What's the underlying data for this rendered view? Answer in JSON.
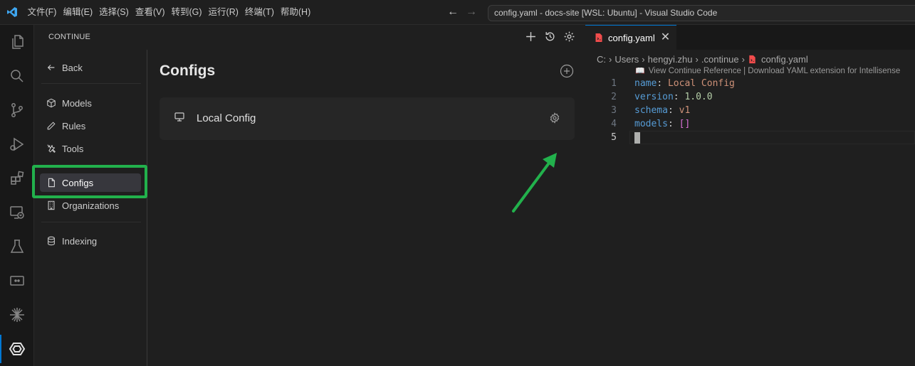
{
  "menu": [
    "文件(F)",
    "编辑(E)",
    "选择(S)",
    "查看(V)",
    "转到(G)",
    "运行(R)",
    "终端(T)",
    "帮助(H)"
  ],
  "window_title": "config.yaml - docs-site [WSL: Ubuntu] - Visual Studio Code",
  "sidebar": {
    "title": "CONTINUE",
    "nav": {
      "back": "Back",
      "models": "Models",
      "rules": "Rules",
      "tools": "Tools",
      "configs": "Configs",
      "organizations": "Organizations",
      "indexing": "Indexing"
    },
    "selected": "Configs"
  },
  "configs": {
    "title": "Configs",
    "items": [
      {
        "name": "Local Config"
      }
    ]
  },
  "editor": {
    "tab": {
      "label": "config.yaml"
    },
    "breadcrumbs": [
      "C:",
      "Users",
      "hengyi.zhu",
      ".continue",
      "config.yaml"
    ],
    "codelens": "View Continue Reference | Download YAML extension for Intellisense",
    "lines": [
      {
        "num": "1",
        "key": "name",
        "value": "Local Config"
      },
      {
        "num": "2",
        "key": "version",
        "value": "1.0.0"
      },
      {
        "num": "3",
        "key": "schema",
        "value": "v1"
      },
      {
        "num": "4",
        "key": "models",
        "value": "[]"
      },
      {
        "num": "5"
      }
    ]
  },
  "colors": {
    "highlight": "#22b14c",
    "accent": "#0078d4",
    "yaml_icon": "#f14c4c"
  }
}
